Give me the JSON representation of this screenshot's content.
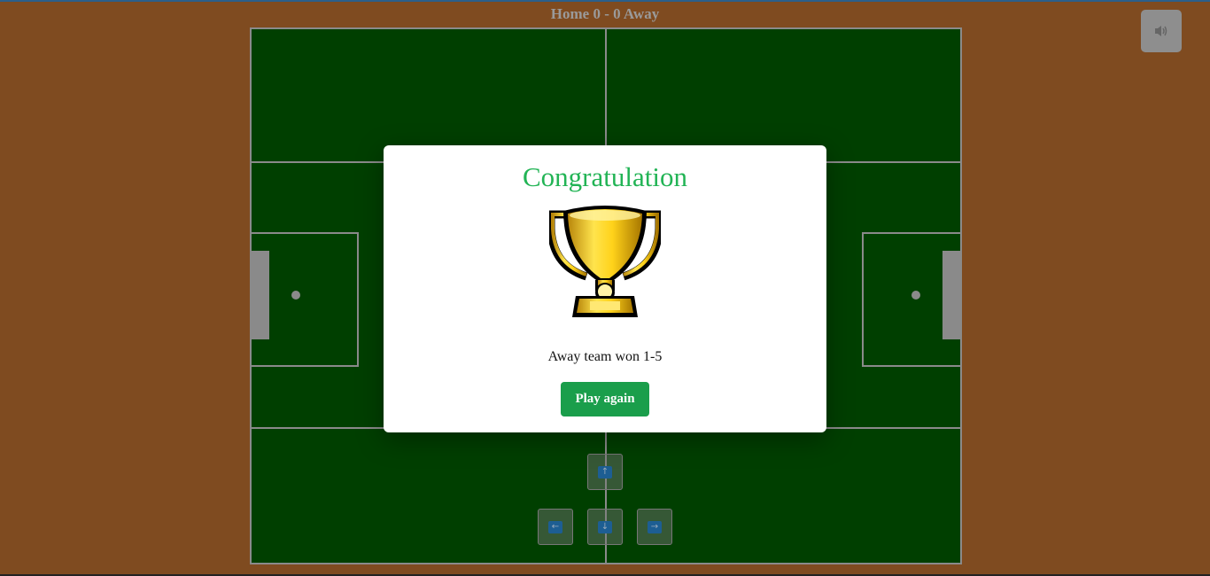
{
  "scoreboard": {
    "text": "Home 0 - 0 Away"
  },
  "sound_button": {
    "icon": "speaker-icon"
  },
  "modal": {
    "title": "Congratulation",
    "trophy_icon": "trophy-icon",
    "result": "Away team won 1-5",
    "button_label": "Play again"
  },
  "controls": {
    "up_icon": "arrow-up-icon",
    "left_icon": "arrow-left-icon",
    "down_icon": "arrow-down-icon",
    "right_icon": "arrow-right-icon",
    "up_glyph": "↑",
    "left_glyph": "←",
    "down_glyph": "↓",
    "right_glyph": "→"
  },
  "colors": {
    "background": "#7f4b20",
    "pitch": "#003f00",
    "lines": "#8a8a8a",
    "title": "#22b455",
    "button": "#1a9e4b"
  }
}
